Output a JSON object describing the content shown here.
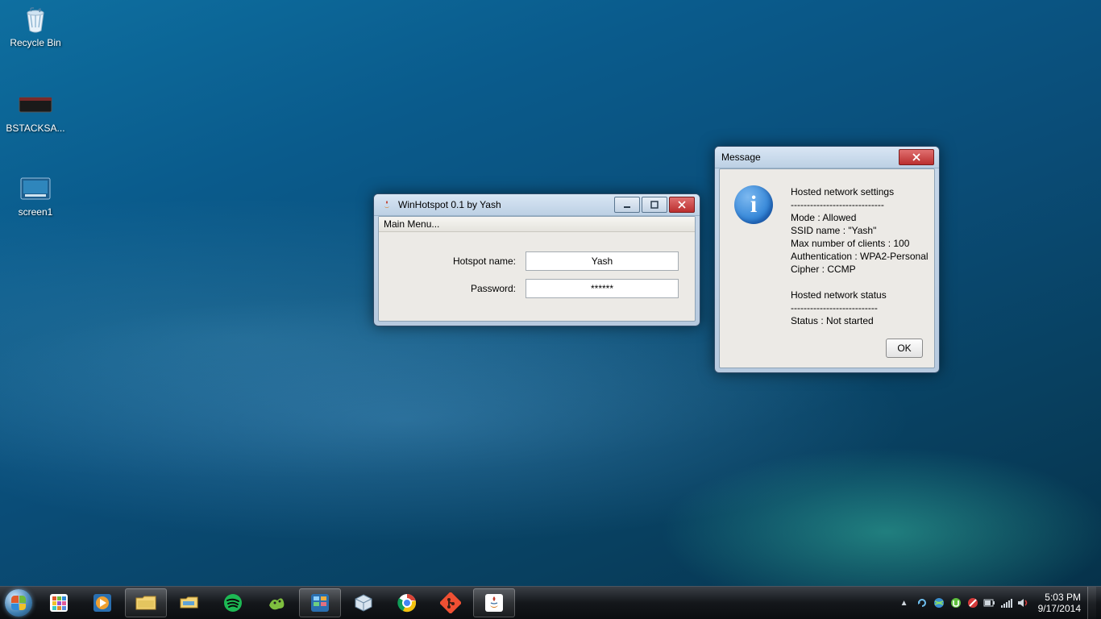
{
  "desktop_icons": {
    "recycle_bin": "Recycle Bin",
    "bstacks": "BSTACKSA...",
    "screen1": "screen1"
  },
  "app_window": {
    "title": "WinHotspot 0.1 by Yash",
    "menu_label": "Main Menu...",
    "hotspot_label": "Hotspot name:",
    "hotspot_value": "Yash",
    "password_label": "Password:",
    "password_value": "******"
  },
  "message_dialog": {
    "title": "Message",
    "heading_settings": "Hosted network settings",
    "dashes": "-----------------------------",
    "mode_line": "Mode : Allowed",
    "ssid_line": "SSID name : \"Yash\"",
    "max_clients_line": "Max number of clients : 100",
    "auth_line": "Authentication : WPA2-Personal",
    "cipher_line": "Cipher : CCMP",
    "heading_status": "Hosted network status",
    "dashes2": "---------------------------",
    "status_line": "Status : Not started",
    "ok_label": "OK"
  },
  "taskbar": {
    "time": "5:03 PM",
    "date": "9/17/2014"
  }
}
